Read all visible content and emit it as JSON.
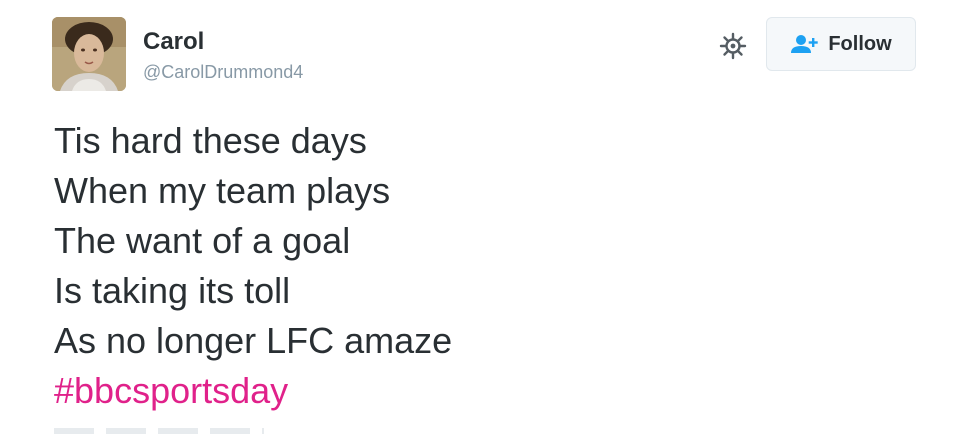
{
  "user": {
    "name": "Carol",
    "handle": "@CarolDrummond4"
  },
  "actions": {
    "follow_label": "Follow"
  },
  "tweet": {
    "lines": [
      "Tis hard these days",
      "When my team plays",
      "The want of a goal",
      "Is taking its toll",
      "As no longer LFC amaze"
    ],
    "hashtag": "#bbcsportsday"
  },
  "icons": {
    "settings": "gear-icon",
    "follow": "add-user-icon"
  },
  "colors": {
    "text": "#292f33",
    "handle": "#8899a6",
    "hashtag": "#e0218a",
    "follow_icon": "#1da1f2"
  }
}
